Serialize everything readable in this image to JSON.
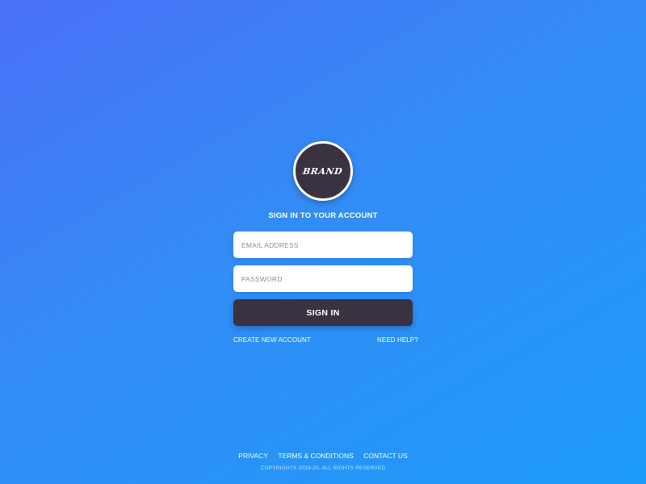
{
  "brand": {
    "logo_text": "BRAND"
  },
  "login": {
    "heading": "SIGN IN TO YOUR ACCOUNT",
    "email_placeholder": "EMAIL ADDRESS",
    "email_value": "",
    "password_placeholder": "PASSWORD",
    "password_value": "",
    "submit_label": "SIGN IN",
    "create_account_label": "CREATE NEW ACCOUNT",
    "need_help_label": "NEED HELP?"
  },
  "footer": {
    "links": [
      "PRIVACY",
      "TERMS & CONDITIONS",
      "CONTACT US"
    ],
    "copyright": "COPYRIGHTS 2019-20. ALL RIGHTS RESERVED"
  },
  "colors": {
    "gradient_start": "#4a70f7",
    "gradient_end": "#1d9bf8",
    "button_dark": "#3a3240",
    "field_background": "#ffffff"
  }
}
